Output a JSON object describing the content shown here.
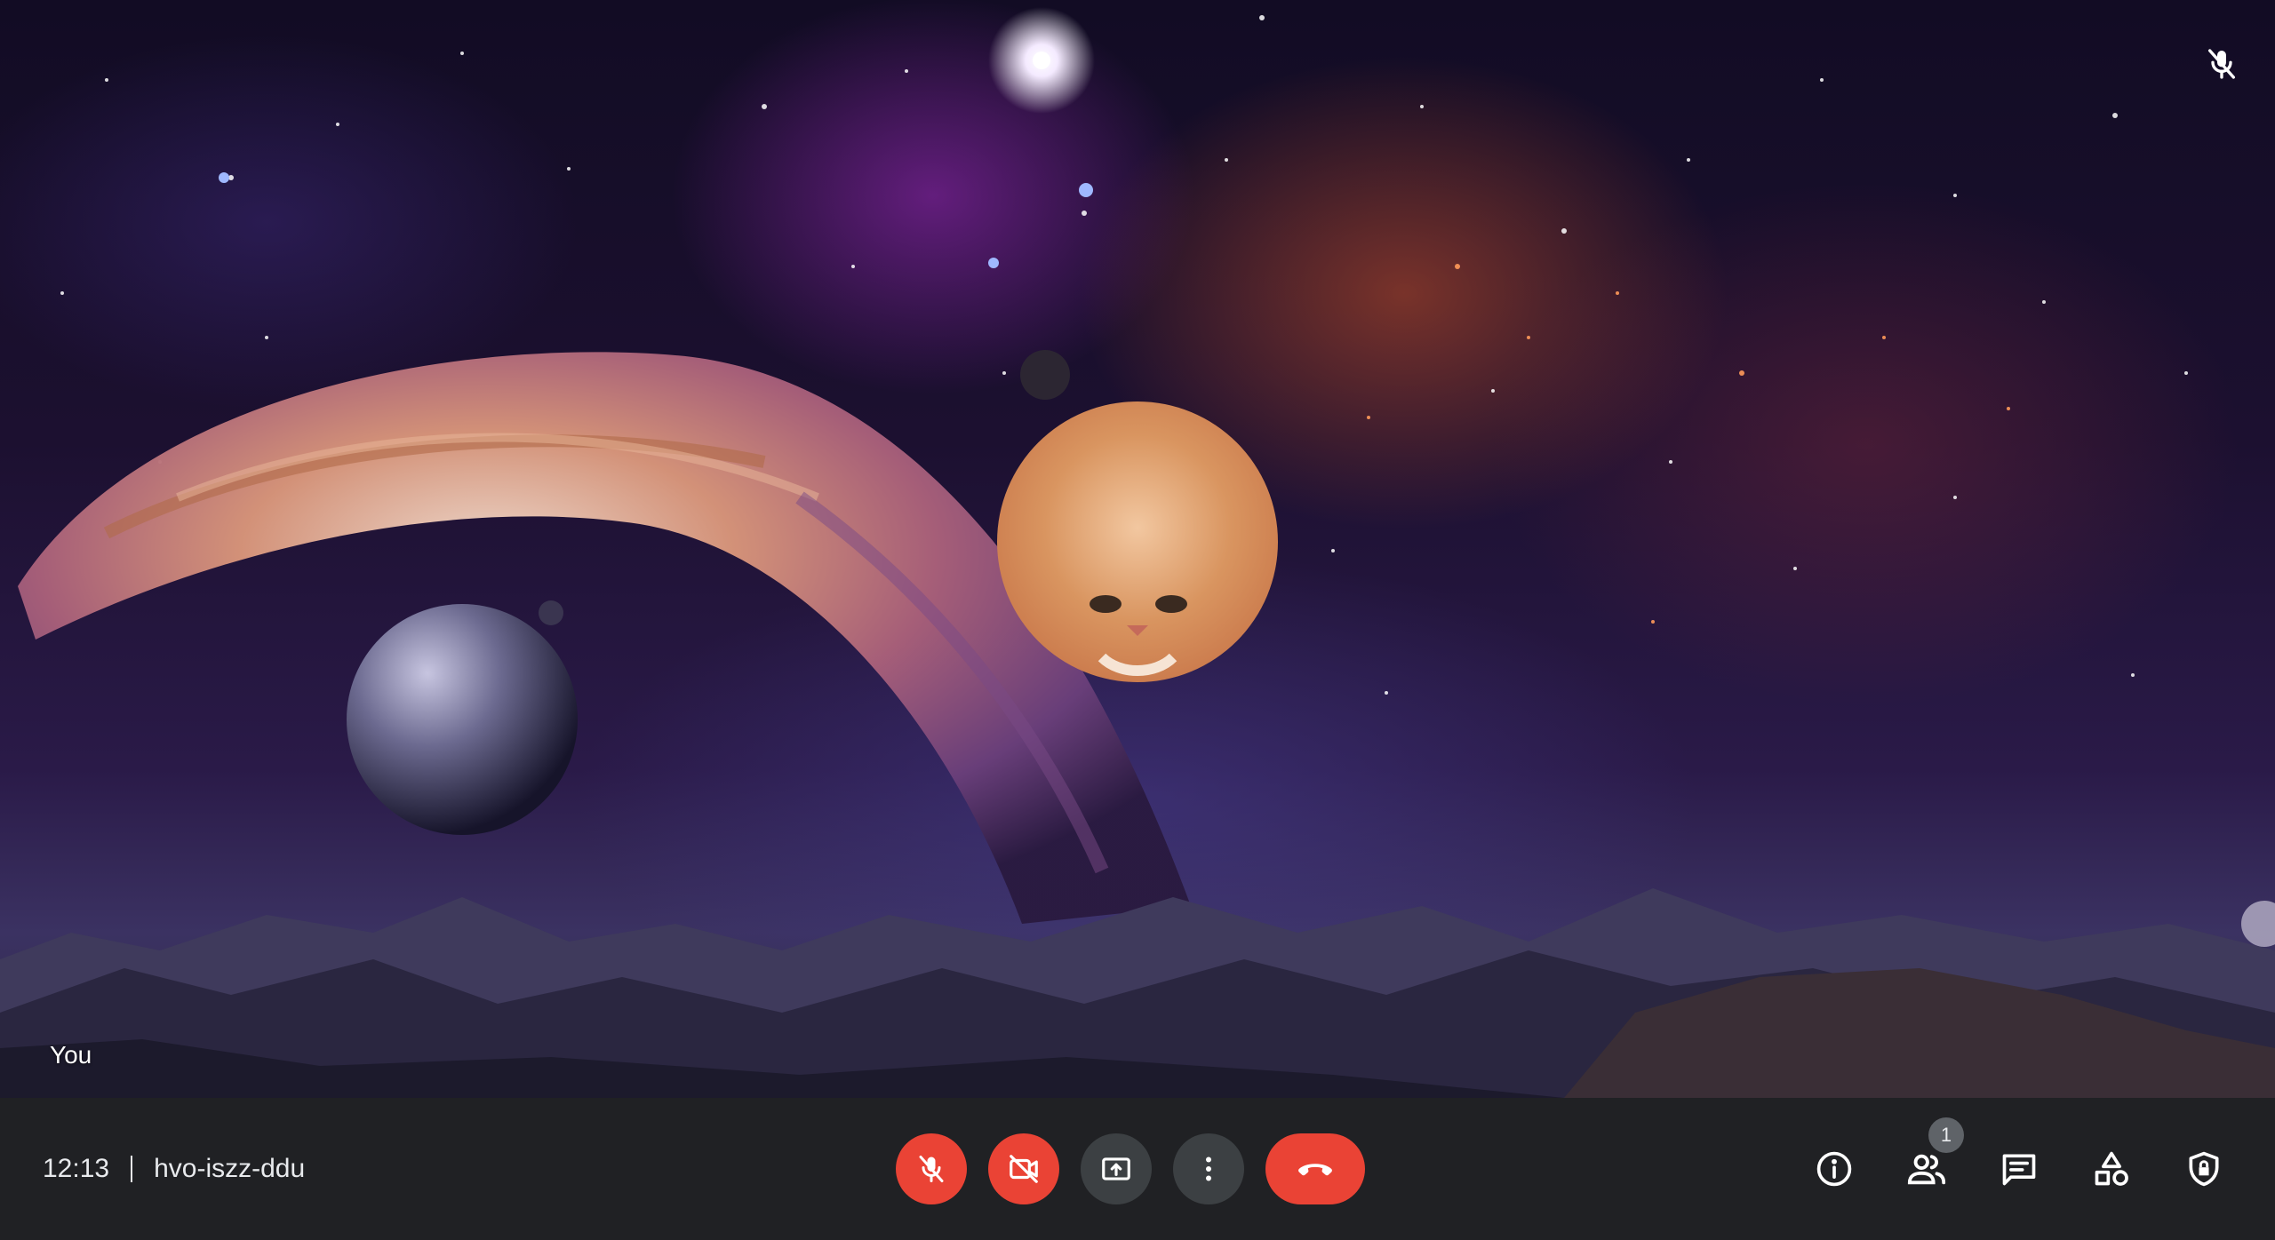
{
  "self_tile": {
    "name_label": "You",
    "mic_status_icon": "mic-off-icon"
  },
  "meeting": {
    "time": "12:13",
    "code": "hvo-iszz-ddu"
  },
  "controls": {
    "mic_icon": "mic-off-icon",
    "camera_icon": "camera-off-icon",
    "present_icon": "present-screen-icon",
    "more_icon": "more-vert-icon",
    "hangup_icon": "call-end-icon"
  },
  "side_panel": {
    "details_icon": "info-icon",
    "people_icon": "people-icon",
    "people_count": "1",
    "chat_icon": "chat-icon",
    "activities_icon": "activities-icon",
    "host_controls_icon": "shield-lock-icon"
  },
  "colors": {
    "bar_background": "#202124",
    "danger": "#ea4335",
    "button_neutral": "#3c4043",
    "text": "#e8eaed"
  }
}
